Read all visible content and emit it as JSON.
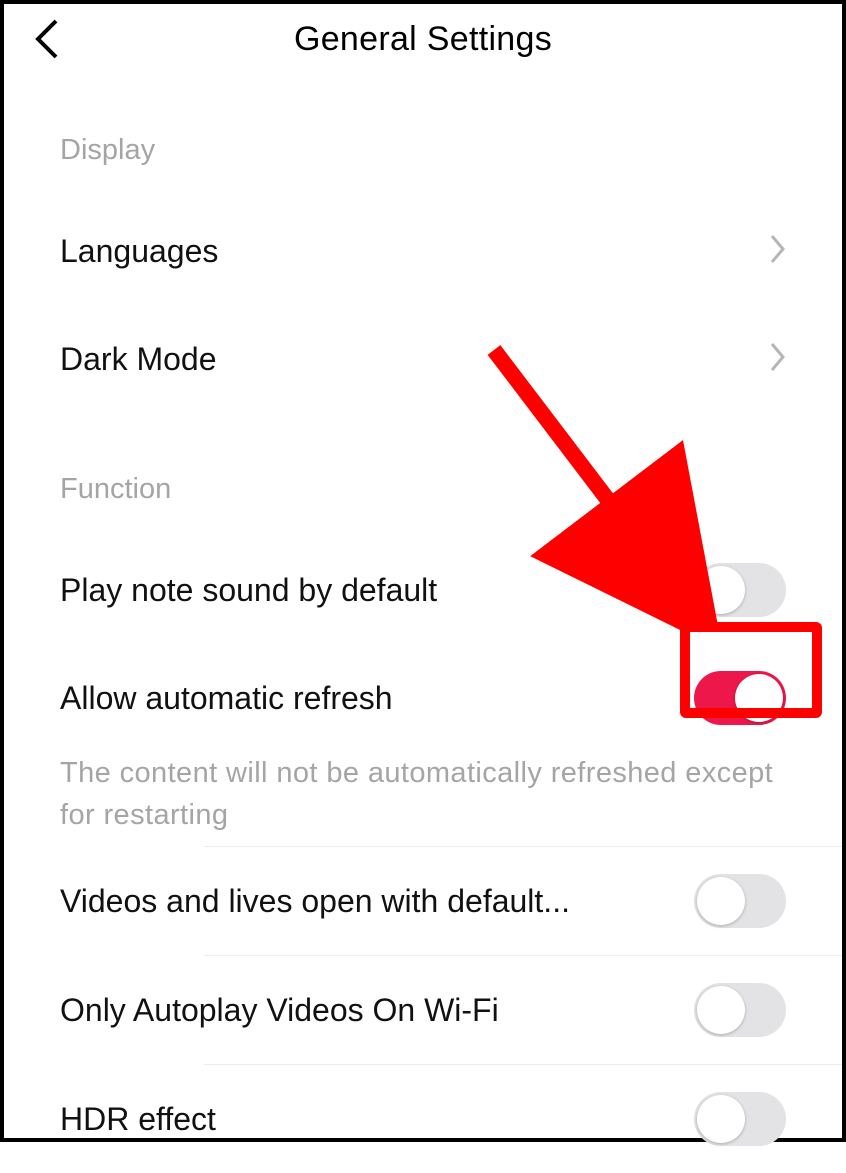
{
  "header": {
    "title": "General Settings"
  },
  "sections": {
    "display": {
      "header": "Display",
      "languages": "Languages",
      "dark_mode": "Dark Mode"
    },
    "function": {
      "header": "Function",
      "play_note_sound": "Play note sound by default",
      "allow_auto_refresh": "Allow automatic refresh",
      "allow_auto_refresh_desc": "The content will not be automatically refreshed except for restarting",
      "videos_lives_default": "Videos and lives open with default...",
      "only_autoplay_wifi": "Only Autoplay Videos On Wi-Fi",
      "hdr_effect": "HDR effect"
    }
  },
  "toggles": {
    "play_note_sound": false,
    "allow_auto_refresh": true,
    "videos_lives_default": false,
    "only_autoplay_wifi": false,
    "hdr_effect": false
  },
  "annotation": {
    "arrow_color": "#ff0000",
    "box_color": "#ff0000"
  }
}
